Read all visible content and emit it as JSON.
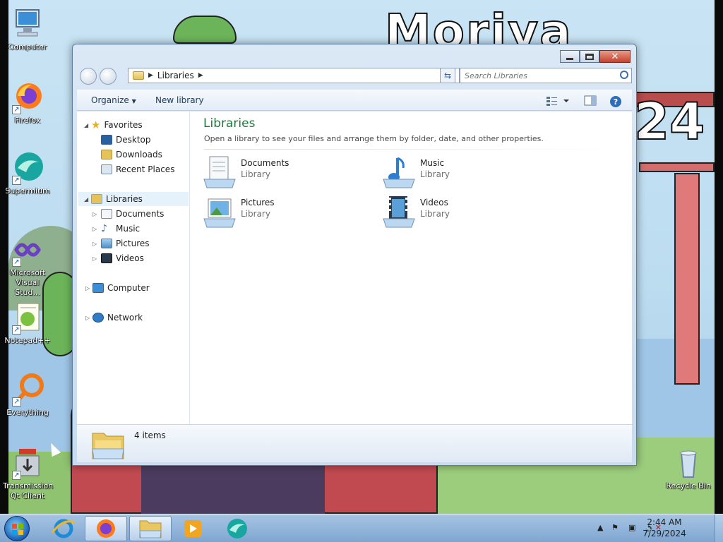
{
  "wallpaper": {
    "title_text": "Moriya Shrine",
    "year_text": "24"
  },
  "desktop_icons": [
    {
      "label": "Computer",
      "icon": "computer-icon"
    },
    {
      "label": "Firefox",
      "icon": "firefox-icon"
    },
    {
      "label": "Supermium",
      "icon": "supermium-icon"
    },
    {
      "label": "Microsoft Visual Stud...",
      "icon": "visual-studio-icon"
    },
    {
      "label": "Notepad++",
      "icon": "notepad-plus-plus-icon"
    },
    {
      "label": "Everything",
      "icon": "everything-search-icon"
    },
    {
      "label": "Transmission Qt Client",
      "icon": "transmission-icon"
    },
    {
      "label": "Recycle Bin",
      "icon": "recycle-bin-icon"
    }
  ],
  "window": {
    "address": {
      "breadcrumb": [
        "Libraries"
      ]
    },
    "search": {
      "placeholder": "Search Libraries"
    },
    "toolbar": {
      "organize": "Organize",
      "new_library": "New library"
    },
    "nav": {
      "favorites": {
        "label": "Favorites",
        "items": [
          "Desktop",
          "Downloads",
          "Recent Places"
        ]
      },
      "libraries": {
        "label": "Libraries",
        "items": [
          "Documents",
          "Music",
          "Pictures",
          "Videos"
        ]
      },
      "computer": "Computer",
      "network": "Network"
    },
    "content": {
      "title": "Libraries",
      "description": "Open a library to see your files and arrange them by folder, date, and other properties.",
      "libraries": [
        {
          "name": "Documents",
          "type": "Library",
          "icon": "documents-library-icon"
        },
        {
          "name": "Music",
          "type": "Library",
          "icon": "music-library-icon"
        },
        {
          "name": "Pictures",
          "type": "Library",
          "icon": "pictures-library-icon"
        },
        {
          "name": "Videos",
          "type": "Library",
          "icon": "videos-library-icon"
        }
      ]
    },
    "details": {
      "count": "4 items"
    }
  },
  "taskbar": {
    "pinned": [
      "internet-explorer-icon",
      "firefox-icon",
      "windows-explorer-icon",
      "media-player-icon",
      "supermium-icon"
    ],
    "clock": {
      "time": "2:44 AM",
      "date": "7/29/2024"
    }
  },
  "colors": {
    "accent_title": "#1e7a3a",
    "selection": "#e5f1fb",
    "close_button": "#c7412c"
  }
}
